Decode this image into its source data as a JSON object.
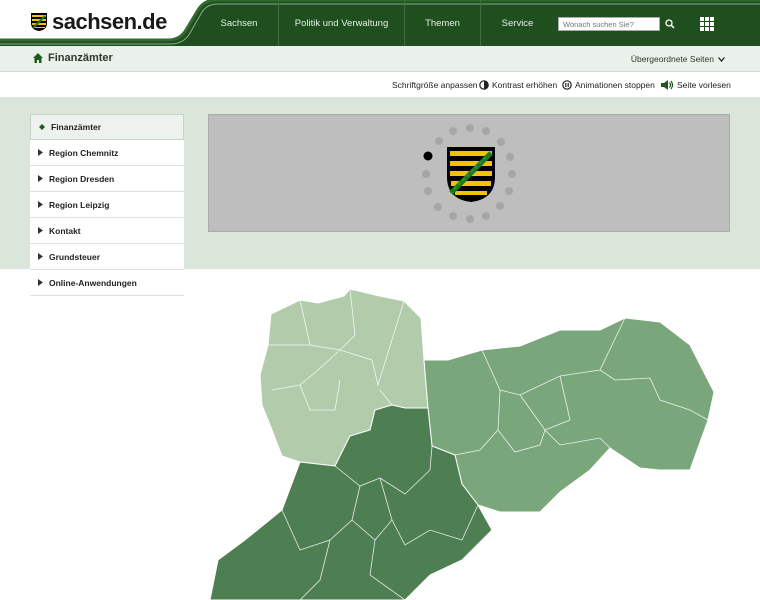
{
  "header": {
    "logo_text": "sachsen.de",
    "nav": [
      {
        "label": "Sachsen"
      },
      {
        "label": "Politik und Verwaltung"
      },
      {
        "label": "Themen"
      },
      {
        "label": "Service"
      }
    ],
    "search_placeholder": "Wonach suchen Sie?"
  },
  "breadcrumb": {
    "title": "Finanzämter",
    "parent_pages": "Übergeordnete Seiten"
  },
  "accessibility": [
    {
      "label": "Schriftgröße anpassen",
      "icon": "none"
    },
    {
      "label": "Kontrast erhöhen",
      "icon": "contrast-icon"
    },
    {
      "label": "Animationen stoppen",
      "icon": "pause-icon"
    },
    {
      "label": "Seite vorlesen",
      "icon": "speaker-icon"
    }
  ],
  "sidebar": {
    "items": [
      {
        "label": "Finanzämter",
        "active": true
      },
      {
        "label": "Region Chemnitz"
      },
      {
        "label": "Region Dresden"
      },
      {
        "label": "Region Leipzig"
      },
      {
        "label": "Kontakt"
      },
      {
        "label": "Grundsteuer"
      },
      {
        "label": "Online-Anwendungen"
      }
    ]
  },
  "colors": {
    "header_green": "#1f4f1f",
    "band": "#dbe6db",
    "map_dark": "#4e7f52",
    "map_mid": "#7aa67b",
    "map_light": "#b1cbab"
  }
}
